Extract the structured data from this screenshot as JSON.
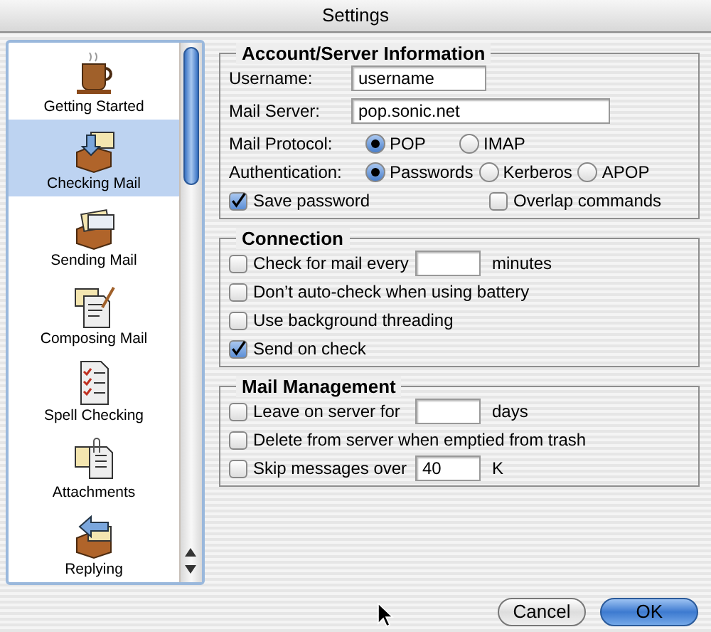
{
  "window": {
    "title": "Settings"
  },
  "sidebar": {
    "items": [
      {
        "label": "Getting Started",
        "selected": false
      },
      {
        "label": "Checking Mail",
        "selected": true
      },
      {
        "label": "Sending Mail",
        "selected": false
      },
      {
        "label": "Composing Mail",
        "selected": false
      },
      {
        "label": "Spell Checking",
        "selected": false
      },
      {
        "label": "Attachments",
        "selected": false
      },
      {
        "label": "Replying",
        "selected": false
      }
    ]
  },
  "sections": [
    {
      "title": "Account/Server Information",
      "rows": [
        {
          "kind": "shortfield",
          "label": "Username:",
          "value": "username"
        },
        {
          "kind": "longfield",
          "label": "Mail Server:",
          "value": "pop.sonic.net"
        },
        {
          "kind": "radio",
          "label": "Mail Protocol:",
          "options": [
            {
              "label": "POP",
              "selected": true
            },
            {
              "label": "IMAP",
              "selected": false
            }
          ]
        },
        {
          "kind": "radio",
          "label": "Authentication:",
          "options": [
            {
              "label": "Passwords",
              "selected": true
            },
            {
              "label": "Kerberos",
              "selected": false
            },
            {
              "label": "APOP",
              "selected": false
            }
          ]
        },
        {
          "kind": "checkpair",
          "items": [
            {
              "label": "Save password",
              "checked": true
            },
            {
              "label": "Overlap commands",
              "checked": false
            }
          ]
        }
      ]
    },
    {
      "title": "Connection",
      "rows": [
        {
          "kind": "checkfield",
          "label": "Check for mail every",
          "checked": false,
          "unit": "minutes"
        },
        {
          "kind": "check",
          "label": "Don’t auto-check when using battery",
          "checked": false
        },
        {
          "kind": "check",
          "label": "Use background threading",
          "checked": false
        },
        {
          "kind": "check",
          "label": "Send on check",
          "checked": true
        }
      ]
    },
    {
      "title": "Mail Management",
      "rows": [
        {
          "kind": "checkfield",
          "label": "Leave on server for",
          "checked": false,
          "unit": "days"
        },
        {
          "kind": "check",
          "label": "Delete from server when emptied from trash",
          "checked": false
        },
        {
          "kind": "checkfield",
          "label": "Skip messages over",
          "checked": false,
          "value": "40",
          "unit": "K"
        }
      ]
    }
  ],
  "buttons": [
    {
      "label": "Cancel",
      "default": false
    },
    {
      "label": "OK",
      "default": true
    }
  ]
}
